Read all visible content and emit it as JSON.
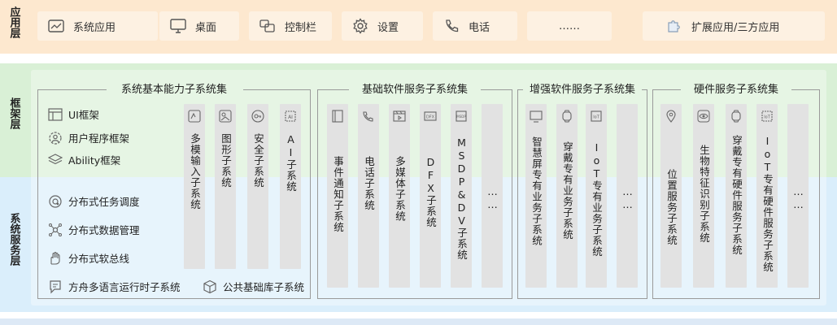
{
  "layers": {
    "app": "应用层",
    "framework": "框架层",
    "system_service": "系统服务层"
  },
  "app_items": [
    {
      "label": "系统应用",
      "icon": "system-app-icon"
    },
    {
      "label": "桌面",
      "icon": "desktop-icon"
    },
    {
      "label": "控制栏",
      "icon": "control-bar-icon"
    },
    {
      "label": "设置",
      "icon": "settings-gear-icon"
    },
    {
      "label": "电话",
      "icon": "phone-icon"
    },
    {
      "label": "……",
      "icon": ""
    },
    {
      "label": "扩展应用/三方应用",
      "icon": "puzzle-icon"
    }
  ],
  "groups": {
    "basic": {
      "title": "系统基本能力子系统集",
      "framework_items": [
        {
          "label": "UI框架",
          "icon": "ui-frame-icon"
        },
        {
          "label": "用户程序框架",
          "icon": "user-program-icon"
        },
        {
          "label": "Ability框架",
          "icon": "ability-layers-icon"
        }
      ],
      "service_items": [
        {
          "label": "分布式任务调度",
          "icon": "task-schedule-icon"
        },
        {
          "label": "分布式数据管理",
          "icon": "data-manage-icon"
        },
        {
          "label": "分布式软总线",
          "icon": "soft-bus-icon"
        },
        {
          "label": "方舟多语言运行时子系统",
          "icon": "ark-runtime-icon"
        },
        {
          "label": "公共基础库子系统",
          "icon": "cube-library-icon"
        }
      ],
      "columns": [
        {
          "label": "多模输入子系统",
          "icon": "multimodal-icon"
        },
        {
          "label": "图形子系统",
          "icon": "graphics-icon"
        },
        {
          "label": "安全子系统",
          "icon": "key-icon"
        },
        {
          "label": "AI子系统",
          "icon": "ai-chip-icon"
        }
      ]
    },
    "software": {
      "title": "基础软件服务子系统集",
      "columns": [
        {
          "label": "事件通知子系统",
          "icon": "book-icon"
        },
        {
          "label": "电话子系统",
          "icon": "telephony-icon"
        },
        {
          "label": "多媒体子系统",
          "icon": "media-icon"
        },
        {
          "label": "DFX子系统",
          "icon": "dfx-chip-icon"
        },
        {
          "label": "MSDP&DV子系统",
          "icon": "msdp-icon"
        },
        {
          "label": "……",
          "icon": ""
        }
      ]
    },
    "enhanced": {
      "title": "增强软件服务子系统集",
      "columns": [
        {
          "label": "智慧屏专有业务子系统",
          "icon": "smart-screen-icon"
        },
        {
          "label": "穿戴专有业务子系统",
          "icon": "watch-icon"
        },
        {
          "label": "IoT专有业务子系统",
          "icon": "iot-chip-icon"
        },
        {
          "label": "……",
          "icon": ""
        }
      ]
    },
    "hardware": {
      "title": "硬件服务子系统集",
      "columns": [
        {
          "label": "位置服务子系统",
          "icon": "location-pin-icon"
        },
        {
          "label": "生物特征识别子系统",
          "icon": "eye-icon"
        },
        {
          "label": "穿戴专有硬件服务子系统",
          "icon": "wear-hw-icon"
        },
        {
          "label": "IoT专有硬件服务子系统",
          "icon": "iot-hw-chip-icon"
        },
        {
          "label": "……",
          "icon": ""
        }
      ]
    }
  }
}
